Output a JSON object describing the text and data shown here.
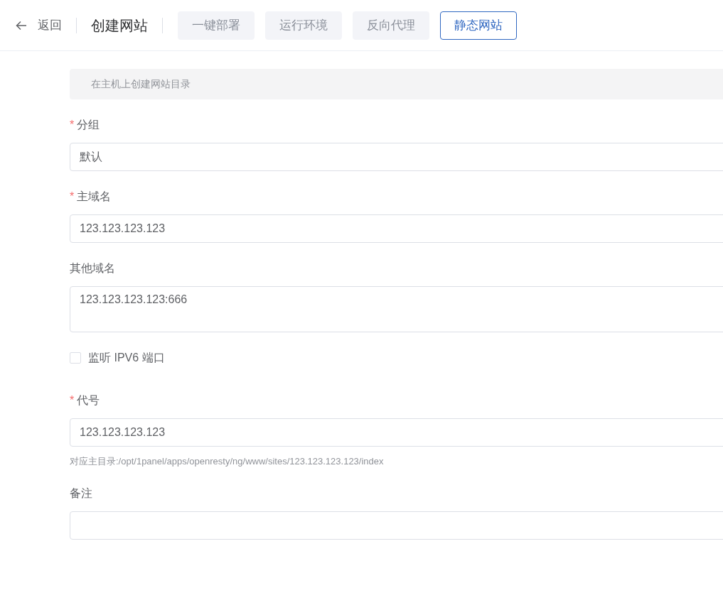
{
  "header": {
    "back": "返回",
    "title": "创建网站",
    "tabs": [
      {
        "label": "一键部署",
        "selected": false
      },
      {
        "label": "运行环境",
        "selected": false
      },
      {
        "label": "反向代理",
        "selected": false
      },
      {
        "label": "静态网站",
        "selected": true
      }
    ]
  },
  "notice": "在主机上创建网站目录",
  "fields": [
    {
      "kind": "input",
      "required_mark": "*",
      "label": "分组",
      "value": "默认"
    },
    {
      "kind": "input",
      "required_mark": "*",
      "label": "主域名",
      "value": "123.123.123.123"
    },
    {
      "kind": "textarea",
      "label": "其他域名",
      "value": "123.123.123.123:666"
    },
    {
      "kind": "checkbox",
      "label": "监听 IPV6 端口",
      "checked": false
    },
    {
      "kind": "input",
      "required_mark": "*",
      "label": "代号",
      "value": "123.123.123.123",
      "hint": "对应主目录:/opt/1panel/apps/openresty/ng/www/sites/123.123.123.123/index"
    },
    {
      "kind": "input",
      "label": "备注"
    }
  ]
}
